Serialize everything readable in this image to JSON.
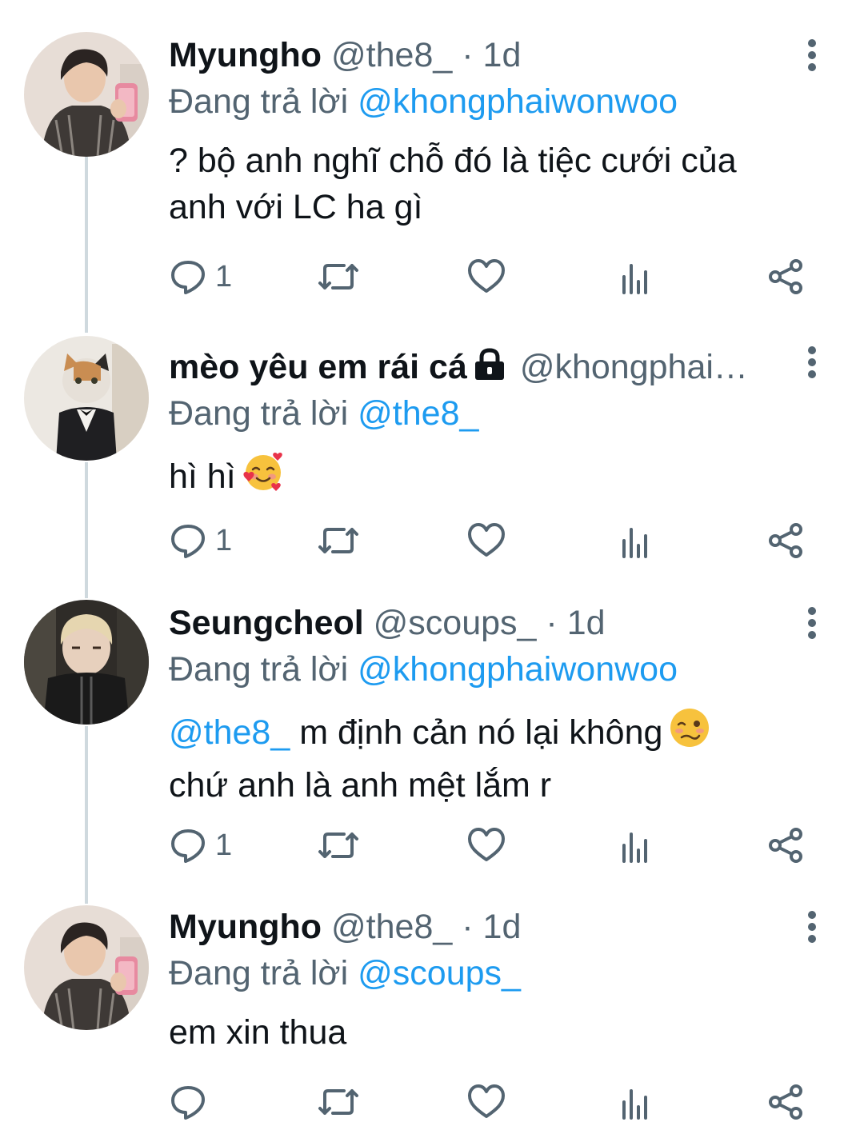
{
  "tweets": [
    {
      "name": "Myungho",
      "handle": "@the8_",
      "separator": "·",
      "time": "1d",
      "reply_prefix": "Đang trả lời",
      "reply_to": "@khongphaiwonwoo",
      "text_line1": "? bộ anh nghĩ chỗ đó là tiệc cưới của",
      "text_line2": "anh với LC ha gì",
      "reply_count": "1",
      "avatar": "avatar-myungho"
    },
    {
      "name": "mèo yêu em rái cá",
      "handle": "@khongphai…",
      "reply_prefix": "Đang trả lời",
      "reply_to": "@the8_",
      "text_line1": "hì hì",
      "emoji": "smiling-face-with-hearts",
      "reply_count": "1",
      "avatar": "avatar-cat-tuxedo",
      "icon": "lock-icon"
    },
    {
      "name": "Seungcheol",
      "handle": "@scoups_",
      "separator": "·",
      "time": "1d",
      "reply_prefix": "Đang trả lời",
      "reply_to": "@khongphaiwonwoo",
      "text_mention": "@the8_",
      "text_line1": " m định cản nó lại không",
      "text_line2": "chứ anh là anh mệt lắm r",
      "emoji": "woozy-face",
      "reply_count": "1",
      "avatar": "avatar-seungcheol"
    },
    {
      "name": "Myungho",
      "handle": "@the8_",
      "separator": "·",
      "time": "1d",
      "reply_prefix": "Đang trả lời",
      "reply_to": "@scoups_",
      "text_line1": "em xin thua",
      "reply_count": "",
      "avatar": "avatar-myungho"
    }
  ],
  "icons": {
    "reply": "reply-icon",
    "retweet": "retweet-icon",
    "like": "heart-icon",
    "views": "views-icon",
    "share": "share-icon",
    "more": "more-vertical-icon"
  },
  "colors": {
    "link": "#1d9bf0",
    "secondary": "#536471",
    "thread_line": "#cfd9de",
    "text": "#0f1419"
  }
}
